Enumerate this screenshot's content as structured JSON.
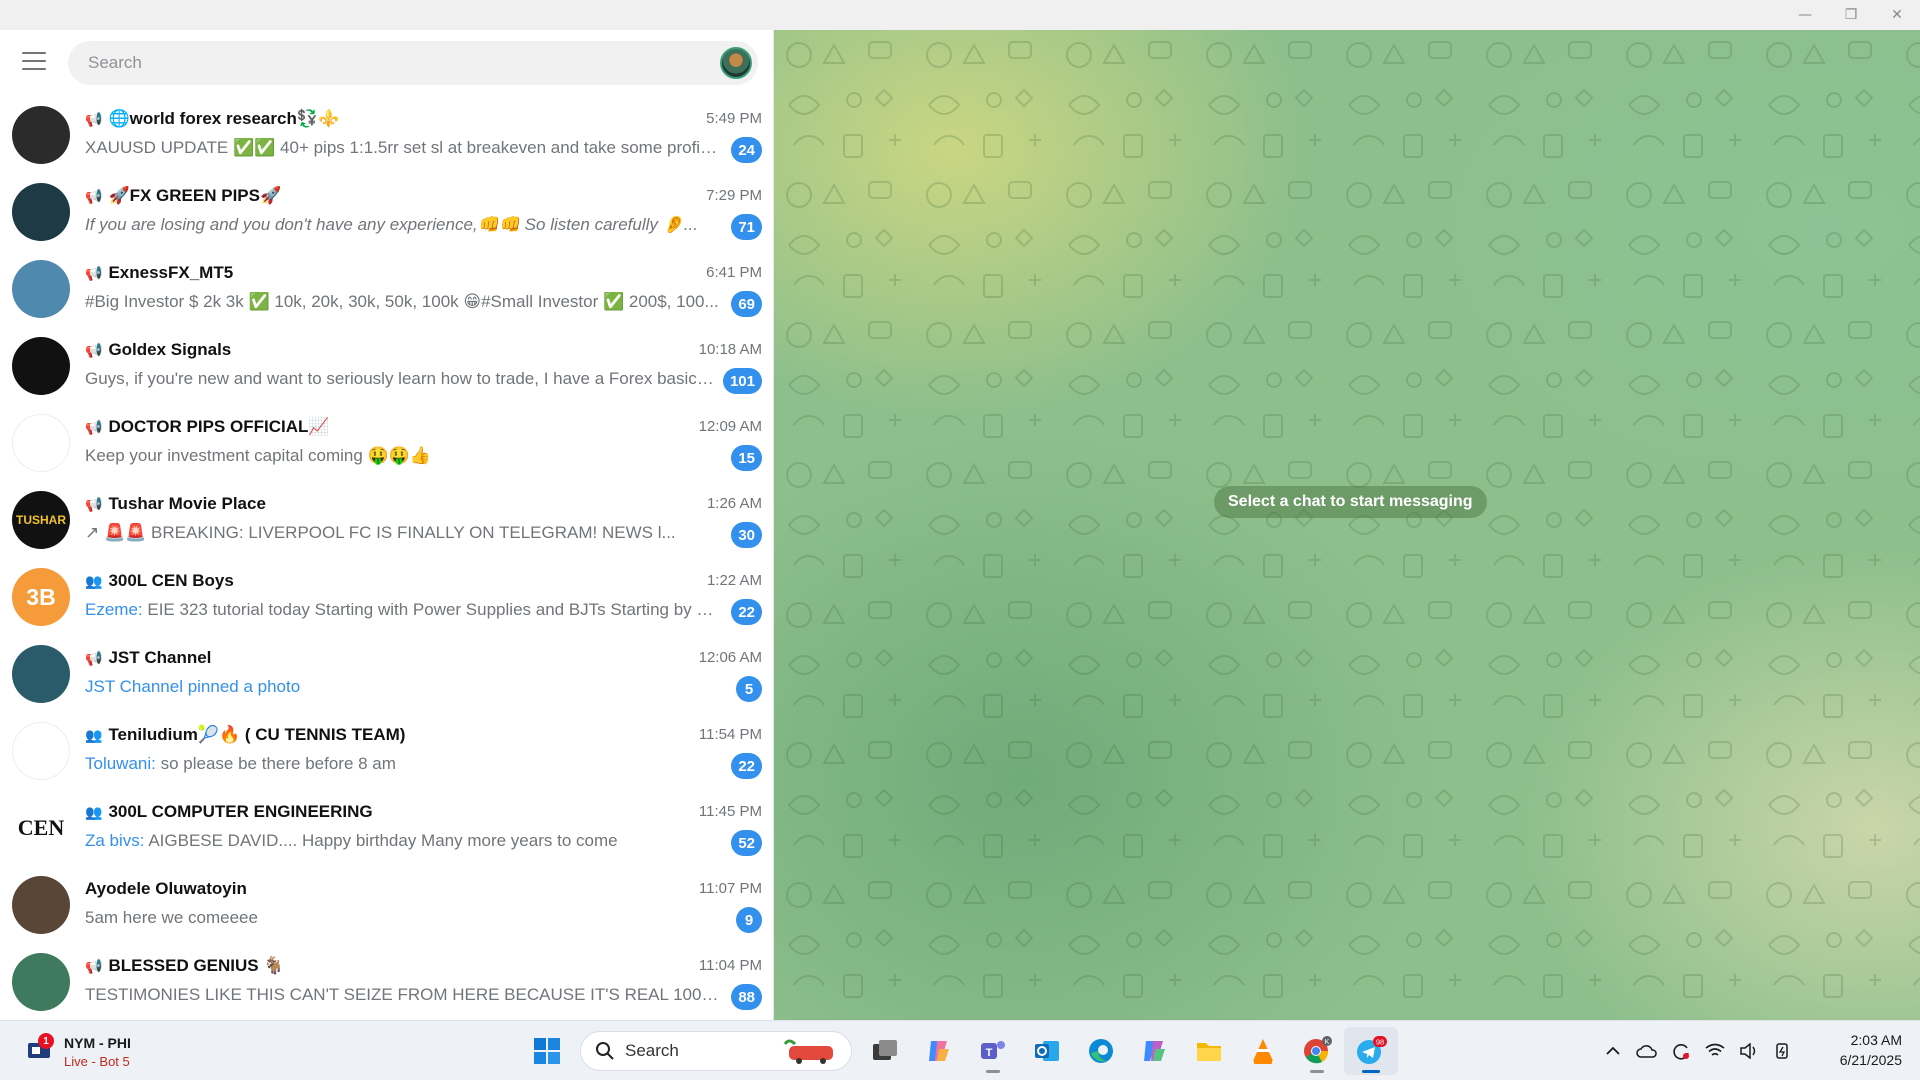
{
  "window": {
    "controls": [
      "—",
      "❐",
      "✕"
    ]
  },
  "search": {
    "placeholder": "Search"
  },
  "chats": [
    {
      "title": "🌐world forex research💱⚜️",
      "type": "channel",
      "time": "5:49 PM",
      "sender": "",
      "preview": "XAUUSD UPDATE ✅✅   40+ pips 1:1.5rr set sl at breakeven and take some profit ...",
      "unread": "24",
      "avatar_color": "#2b2b2b",
      "avatar_text": ""
    },
    {
      "title": "🚀FX GREEN PIPS🚀",
      "type": "channel",
      "time": "7:29 PM",
      "sender": "",
      "preview": "If you are losing and you don't have any experience,👊👊 So listen carefully 👂...",
      "italic": true,
      "unread": "71",
      "avatar_color": "#1d3a45",
      "avatar_text": ""
    },
    {
      "title": "ExnessFX_MT5",
      "type": "channel",
      "time": "6:41 PM",
      "sender": "",
      "preview": "#Big Investor  $ 2k 3k  ✅ 10k, 20k, 30k, 50k, 100k  😁#Small Investor  ✅ 200$, 100...",
      "unread": "69",
      "avatar_color": "#4f89ae",
      "avatar_text": ""
    },
    {
      "title": "Goldex Signals",
      "type": "channel",
      "time": "10:18 AM",
      "sender": "",
      "preview": "Guys, if you're new and want to seriously learn how to trade, I have a Forex basics ...",
      "unread": "101",
      "avatar_color": "#111111",
      "avatar_text": ""
    },
    {
      "title": "DOCTOR PIPS OFFICIAL📈",
      "type": "channel",
      "time": "12:09 AM",
      "sender": "",
      "preview": "Keep your investment capital coming 🤑🤑👍",
      "unread": "15",
      "avatar_color": "#ffffff",
      "avatar_text": ""
    },
    {
      "title": "Tushar Movie Place",
      "type": "channel",
      "time": "1:26 AM",
      "sender": "",
      "preview": "↗ 🚨🚨 BREAKING:  LIVERPOOL FC IS FINALLY ON TELEGRAM!  NEWS  l...",
      "unread": "30",
      "avatar_color": "#111111",
      "avatar_text": "TUSHAR"
    },
    {
      "title": "300L CEN Boys",
      "type": "group",
      "time": "1:22 AM",
      "sender": "Ezeme:",
      "preview": " EIE 323 tutorial today Starting with Power Supplies and BJTs Starting by 2pm...",
      "unread": "22",
      "avatar_color": "#f59b3a",
      "avatar_text": "3B"
    },
    {
      "title": "JST Channel",
      "type": "channel",
      "time": "12:06 AM",
      "sender": "JST Channel pinned a photo",
      "preview": "",
      "unread": "5",
      "avatar_color": "#2a5b6b",
      "avatar_text": ""
    },
    {
      "title": "Teniludium🎾🔥 ( CU TENNIS TEAM)",
      "type": "group",
      "time": "11:54 PM",
      "sender": "Toluwani:",
      "preview": " so please be there before 8 am",
      "unread": "22",
      "avatar_color": "#ffffff",
      "avatar_text": ""
    },
    {
      "title": "300L COMPUTER ENGINEERING",
      "type": "group",
      "time": "11:45 PM",
      "sender": "Za bivs:",
      "preview": " AIGBESE DAVID.... Happy birthday  Many more years to come",
      "unread": "52",
      "avatar_color": "#ffffff",
      "avatar_text": "CEN"
    },
    {
      "title": "Ayodele Oluwatoyin",
      "type": "user",
      "time": "11:07 PM",
      "sender": "",
      "preview": "5am here we comeeee",
      "unread": "9",
      "avatar_color": "#5a4636",
      "avatar_text": ""
    },
    {
      "title": "BLESSED GENIUS 🐐",
      "type": "channel",
      "time": "11:04 PM",
      "sender": "",
      "preview": "TESTIMONIES LIKE THIS CAN'T SEIZE FROM HERE BECAUSE IT'S REAL 100% a...",
      "unread": "88",
      "avatar_color": "#3f7a5e",
      "avatar_text": ""
    }
  ],
  "main": {
    "empty_text": "Select a chat to start messaging"
  },
  "taskbar": {
    "widget_line1": "NYM - PHI",
    "widget_line2": "Live - Bot 5",
    "widget_badge": "1",
    "search_label": "Search",
    "telegram_badge": "98",
    "chrome_badge": "K",
    "time": "2:03 AM",
    "date": "6/21/2025"
  },
  "colors": {
    "accent": "#3390ec",
    "chat_bg": "#8dbf8c"
  }
}
